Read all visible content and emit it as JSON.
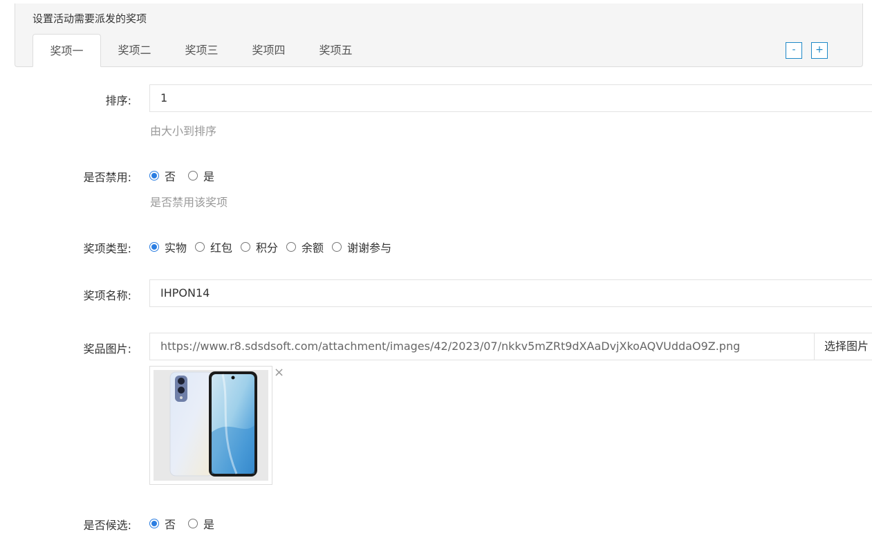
{
  "panel": {
    "title": "设置活动需要派发的奖项",
    "tabs": [
      "奖项一",
      "奖项二",
      "奖项三",
      "奖项四",
      "奖项五"
    ],
    "active_tab": 0,
    "minus_label": "-",
    "plus_label": "+"
  },
  "form": {
    "sort": {
      "label": "排序:",
      "value": "1",
      "help": "由大小到排序"
    },
    "disabled": {
      "label": "是否禁用:",
      "options": [
        "否",
        "是"
      ],
      "selected": 0,
      "help": "是否禁用该奖项"
    },
    "prize_type": {
      "label": "奖项类型:",
      "options": [
        "实物",
        "红包",
        "积分",
        "余额",
        "谢谢参与"
      ],
      "selected": 0
    },
    "prize_name": {
      "label": "奖项名称:",
      "value": "IHPON14"
    },
    "prize_image": {
      "label": "奖品图片:",
      "value": "https://www.r8.sdsdsoft.com/attachment/images/42/2023/07/nkkv5mZRt9dXAaDvjXkoAQVUddaO9Z.png",
      "select_label": "选择图片",
      "remove_icon": "×"
    },
    "candidate": {
      "label": "是否候选:",
      "options": [
        "否",
        "是"
      ],
      "selected": 0
    }
  },
  "colors": {
    "accent": "#2a7de1",
    "button_border": "#1e88c7",
    "help_text": "#999999"
  }
}
